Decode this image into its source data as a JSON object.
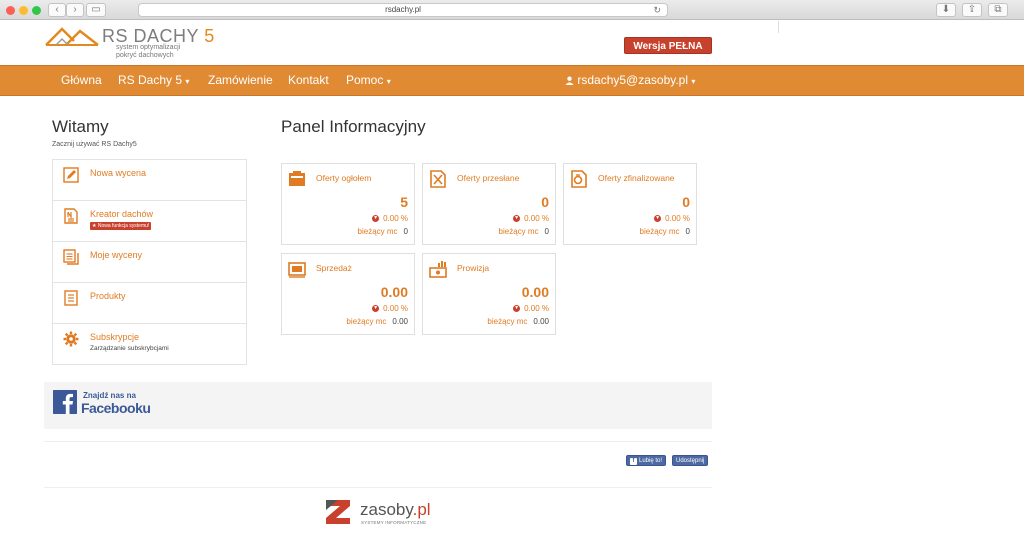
{
  "browser": {
    "url": "rsdachy.pl"
  },
  "logo": {
    "title_main": "RS DACHY",
    "title_num": "5",
    "sub1": "system optymalizacji",
    "sub2": "pokryć dachowych"
  },
  "header": {
    "full_version": "Wersja PEŁNA"
  },
  "nav": {
    "items": [
      "Główna",
      "RS Dachy 5",
      "Zamówienie",
      "Kontakt",
      "Pomoc"
    ],
    "user": "rsdachy5@zasoby.pl"
  },
  "welcome": {
    "title": "Witamy",
    "subtitle": "Zacznij używać RS Dachy5"
  },
  "menu": [
    {
      "label": "Nowa wycena"
    },
    {
      "label": "Kreator dachów",
      "badge": "★ Nowa funkcja systemu!"
    },
    {
      "label": "Moje wyceny"
    },
    {
      "label": "Produkty"
    },
    {
      "label": "Subskrypcje",
      "desc": "Zarządzanie subskrybcjami"
    }
  ],
  "panel": {
    "title": "Panel Informacyjny",
    "cards": [
      {
        "title": "Oferty ogłołem",
        "value": "5",
        "change": "0.00 %",
        "current_label": "bieżący mc",
        "current": "0"
      },
      {
        "title": "Oferty przesłane",
        "value": "0",
        "change": "0.00 %",
        "current_label": "bieżący mc",
        "current": "0"
      },
      {
        "title": "Oferty zfinalizowane",
        "value": "0",
        "change": "0.00 %",
        "current_label": "bieżący mc",
        "current": "0"
      },
      {
        "title": "Sprzedaż",
        "value": "0.00",
        "change": "0.00 %",
        "current_label": "bieżący mc",
        "current": "0.00"
      },
      {
        "title": "Prowizja",
        "value": "0.00",
        "change": "0.00 %",
        "current_label": "bieżący mc",
        "current": "0.00"
      }
    ]
  },
  "facebook": {
    "line1": "Znajdź nas na",
    "line2": "Facebooku"
  },
  "social": {
    "like": "Lubię to!",
    "share": "Udostępnij"
  },
  "footer": {
    "brand": "zasoby",
    "tld": ".pl",
    "sub": "SYSTEMY INFORMATYCZNE"
  },
  "colors": {
    "accent": "#e08a34",
    "link": "#e07b23",
    "badge": "#c8412c",
    "facebook": "#3b5998"
  }
}
